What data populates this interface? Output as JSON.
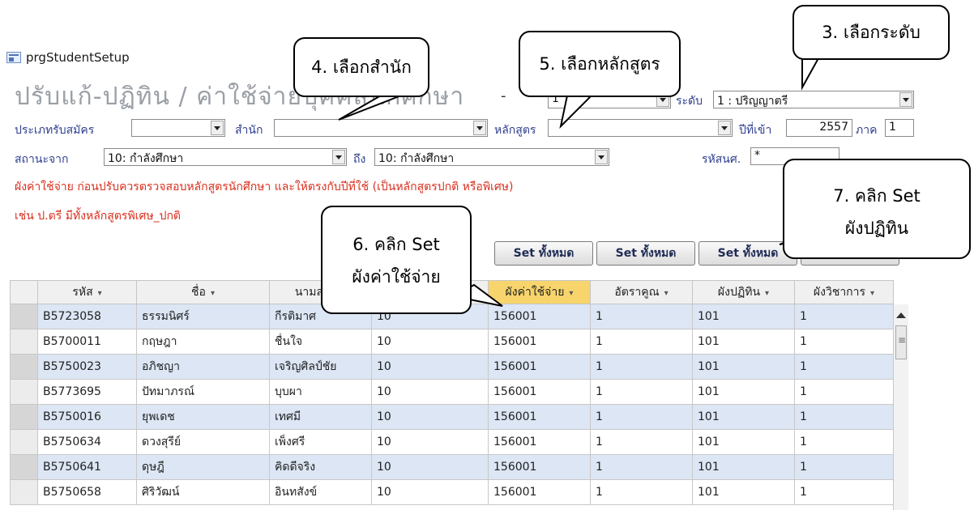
{
  "window": {
    "title": "prgStudentSetup"
  },
  "header": {
    "title": "ปรับแก้-ปฏิทิน / ค่าใช้จ่ายบุคคลนักศึกษา",
    "dash": "-",
    "year_combo_value": "1",
    "level_label": "ระดับ",
    "level_value": "1 : ปริญญาตรี"
  },
  "filters": {
    "admission_type_label": "ประเภทรับสมัคร",
    "office_label": "สำนัก",
    "curriculum_label": "หลักสูตร",
    "entry_year_label": "ปีที่เข้า",
    "entry_year_value": "2557",
    "term_label": "ภาค",
    "term_value": "1",
    "status_from_label": "สถานะจาก",
    "status_from_value": "10: กำลังศึกษา",
    "status_to_label": "ถึง",
    "status_to_value": "10: กำลังศึกษา",
    "student_id_label": "รหัสนศ.",
    "student_id_value": "*"
  },
  "notes": {
    "line1": "ผังค่าใช้จ่าย ก่อนปรับควรตรวจสอบหลักสูตรนักศึกษา และให้ตรงกับปีที่ใช้ (เป็นหลักสูตรปกติ หรือพิเศษ)",
    "line2": "เช่น ป.ตรี มีทั้งหลักสูตรพิเศษ_ปกติ"
  },
  "buttons": {
    "set_all_1": "Set ทั้งหมด",
    "set_all_2": "Set ทั้งหมด",
    "set_all_3": "Set ทั้งหมด"
  },
  "callouts": {
    "c3": "3. เลือกระดับ",
    "c4": "4. เลือกสำนัก",
    "c5": "5. เลือกหลักสูตร",
    "c6_line1": "6. คลิก Set",
    "c6_line2": "ผังค่าใช้จ่าย",
    "c7_line1": "7. คลิก Set",
    "c7_line2": "ผังปฏิทิน"
  },
  "grid": {
    "columns": [
      "รหัส",
      "ชื่อ",
      "นามสกุล",
      "",
      "ผังค่าใช้จ่าย",
      "อัตราคูณ",
      "ผังปฏิทิน",
      "ผังวิชาการ"
    ],
    "rows": [
      [
        "B5723058",
        "ธรรมนิศร์",
        "กีรติมาศ",
        "10",
        "156001",
        "1",
        "101",
        "1"
      ],
      [
        "B5700011",
        "กฤษฎา",
        "ชื่นใจ",
        "10",
        "156001",
        "1",
        "101",
        "1"
      ],
      [
        "B5750023",
        "อภิชญา",
        "เจริญศิลป์ชัย",
        "10",
        "156001",
        "1",
        "101",
        "1"
      ],
      [
        "B5773695",
        "ปัทมาภรณ์",
        "บุบผา",
        "10",
        "156001",
        "1",
        "101",
        "1"
      ],
      [
        "B5750016",
        "ยุพเดช",
        "เทศมี",
        "10",
        "156001",
        "1",
        "101",
        "1"
      ],
      [
        "B5750634",
        "ดวงสุรีย์",
        "เพ็งศรี",
        "10",
        "156001",
        "1",
        "101",
        "1"
      ],
      [
        "B5750641",
        "ดุษฎี",
        "คิดดีจริง",
        "10",
        "156001",
        "1",
        "101",
        "1"
      ],
      [
        "B5750658",
        "ศิริวัฒน์",
        "อินทสังข์",
        "10",
        "156001",
        "1",
        "101",
        "1"
      ]
    ]
  }
}
